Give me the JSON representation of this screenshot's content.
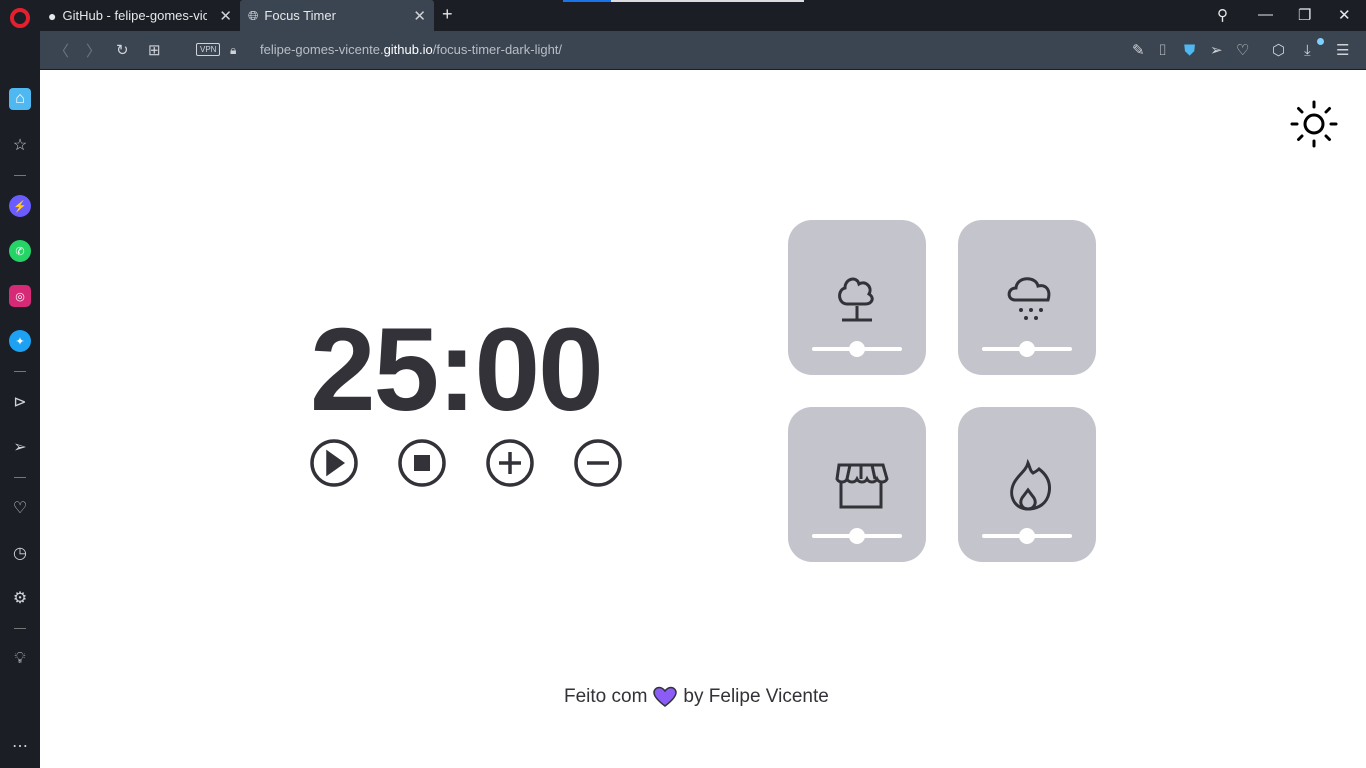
{
  "browser": {
    "tabs": [
      {
        "title": "GitHub - felipe-gomes-vicente",
        "icon": "github-icon"
      },
      {
        "title": "Focus Timer",
        "icon": "globe-icon",
        "active": true
      }
    ],
    "url_prefix": "felipe-gomes-vicente.",
    "url_domain": "github.io",
    "url_path": "/focus-timer-dark-light/",
    "vpn_label": "VPN",
    "accent": "#4fb8f0"
  },
  "timer": {
    "display": "25:00",
    "minutes": "25",
    "seconds": "00"
  },
  "controls": [
    {
      "name": "play"
    },
    {
      "name": "stop"
    },
    {
      "name": "plus"
    },
    {
      "name": "minus"
    }
  ],
  "sounds": [
    {
      "name": "forest",
      "icon": "tree-icon",
      "volume": 0.5
    },
    {
      "name": "rain",
      "icon": "rain-cloud-icon",
      "volume": 0.5
    },
    {
      "name": "coffee-shop",
      "icon": "store-icon",
      "volume": 0.5
    },
    {
      "name": "fireplace",
      "icon": "flame-icon",
      "volume": 0.5
    }
  ],
  "footer": {
    "prefix": "Feito com",
    "suffix": "by Felipe Vicente",
    "heart_color": "#8b5cf6"
  },
  "colors": {
    "card": "#c4c4cc",
    "text": "#323238"
  }
}
